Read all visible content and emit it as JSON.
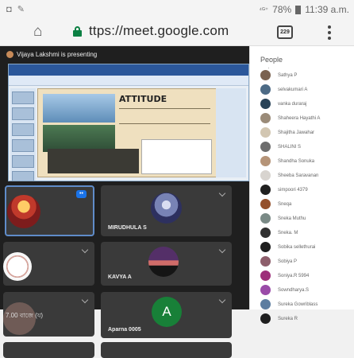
{
  "status": {
    "left": "◘ ✎",
    "signal": "⁴ᴳ⁺",
    "battery": "78%",
    "time": "11:39 a.m."
  },
  "browser": {
    "url": "ttps://meet.google.com",
    "tab_count": "229",
    "icons": [
      "home-icon",
      "lock-icon",
      "tab-switcher-icon",
      "more-vert-icon"
    ]
  },
  "meet": {
    "presenting_text": "Vijaya Lakshmi is presenting",
    "slide_title": "ATTITUDE",
    "tiles": [
      {
        "name": "",
        "color": "#3a3a3a"
      },
      {
        "name": "MIRUDHULA S",
        "color": "#3a3a3a"
      },
      {
        "name": "",
        "color": "#3a3a3a"
      },
      {
        "name": "KAVYA A",
        "color": "#3a3a3a"
      },
      {
        "name": "",
        "color": "#3a3a3a"
      },
      {
        "name": "Aparna 0005",
        "color": "#3a3a3a"
      }
    ],
    "small_tile_text": "7.00 বাজে (য)",
    "letter": "A",
    "active_badge": "••"
  },
  "people": {
    "title": "People",
    "count_hint": "·",
    "participants": [
      {
        "name": "Sathya P",
        "color": "#7a6250"
      },
      {
        "name": "selvakumari A",
        "color": "#4d6b86"
      },
      {
        "name": "vanka duraraj",
        "color": "#284257"
      },
      {
        "name": "Shaheera Hayathi A",
        "color": "#9a8b78"
      },
      {
        "name": "Shajitha Jawahar",
        "color": "#d2c6b1"
      },
      {
        "name": "SHALINI S",
        "color": "#6d6d6d"
      },
      {
        "name": "Shandha Sonuka",
        "color": "#b59478"
      },
      {
        "name": "Sheeba Saravanan",
        "color": "#d8d4cf"
      },
      {
        "name": "simpoori 4379",
        "color": "#202020"
      },
      {
        "name": "Sneqa",
        "color": "#94502b"
      },
      {
        "name": "Sneka Muthu",
        "color": "#7a8a86"
      },
      {
        "name": "Sneka. M",
        "color": "#303030"
      },
      {
        "name": "Sobika sellethurai",
        "color": "#1e1e1e"
      },
      {
        "name": "Sobiya P",
        "color": "#8d5e6b"
      },
      {
        "name": "Soniya.R 5994",
        "color": "#9d2f7a"
      },
      {
        "name": "Sowndharya.S",
        "color": "#9a4ba8"
      },
      {
        "name": "Sureka Gowriblass",
        "color": "#5c7da0"
      },
      {
        "name": "Sureka R",
        "color": "#1f1f1f"
      }
    ]
  }
}
